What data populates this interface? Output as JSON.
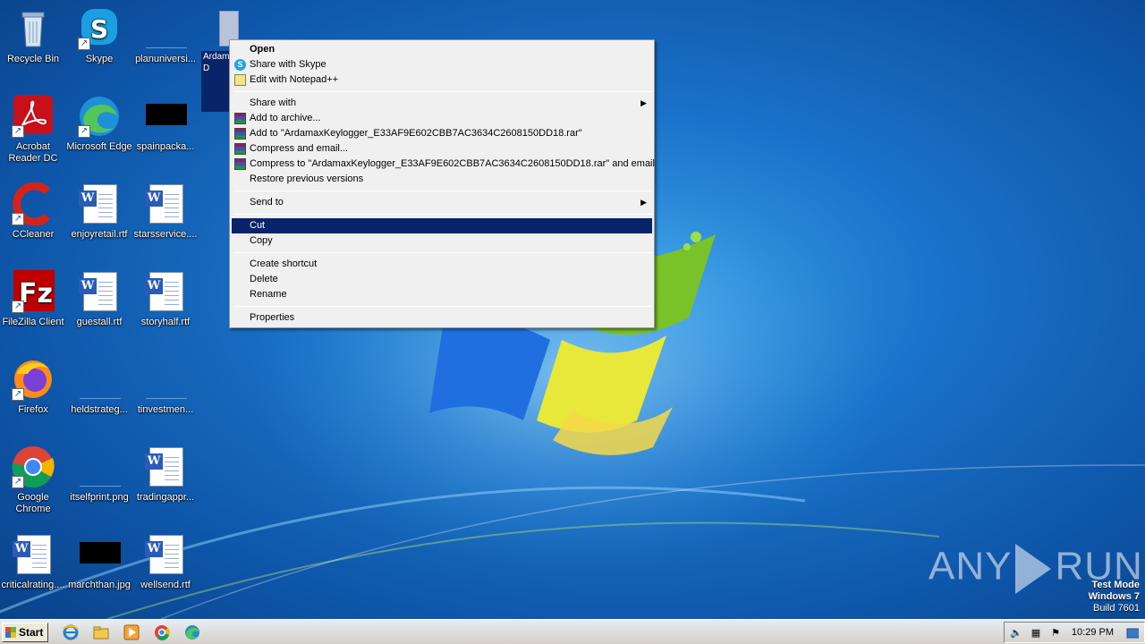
{
  "desktop": {
    "icons": [
      {
        "label": "Recycle Bin",
        "icon": "recycle-bin-icon"
      },
      {
        "label": "Skype",
        "icon": "skype-icon"
      },
      {
        "label": "planuniversi...",
        "icon": "blank-image-icon"
      },
      {
        "label": "Acrobat Reader DC",
        "icon": "acrobat-icon"
      },
      {
        "label": "Microsoft Edge",
        "icon": "edge-icon"
      },
      {
        "label": "spainpacka...",
        "icon": "black-image-icon"
      },
      {
        "label": "CCleaner",
        "icon": "ccleaner-icon"
      },
      {
        "label": "enjoyretail.rtf",
        "icon": "word-doc-icon"
      },
      {
        "label": "starsservice....",
        "icon": "word-doc-icon"
      },
      {
        "label": "FileZilla Client",
        "icon": "filezilla-icon"
      },
      {
        "label": "guestall.rtf",
        "icon": "word-doc-icon"
      },
      {
        "label": "storyhalf.rtf",
        "icon": "word-doc-icon"
      },
      {
        "label": "Firefox",
        "icon": "firefox-icon"
      },
      {
        "label": "heldstrateg...",
        "icon": "blank-image-icon"
      },
      {
        "label": "tinvestmen...",
        "icon": "blank-image-icon"
      },
      {
        "label": "Google Chrome",
        "icon": "chrome-icon"
      },
      {
        "label": "itselfprint.png",
        "icon": "blank-image-icon"
      },
      {
        "label": "tradingappr...",
        "icon": "word-doc-icon"
      },
      {
        "label": "criticalrating....",
        "icon": "word-doc-icon"
      },
      {
        "label": "marchthan.jpg",
        "icon": "black-image-icon"
      },
      {
        "label": "wellsend.rtf",
        "icon": "word-doc-icon"
      }
    ],
    "selected_file_label": "Ardamaxgger_E33602CB34C260 D"
  },
  "context_menu": {
    "items": [
      {
        "label": "Open",
        "bold": true
      },
      {
        "label": "Share with Skype",
        "icon": "skype"
      },
      {
        "label": "Edit with Notepad++",
        "icon": "notepad"
      },
      {
        "label": "Share with",
        "submenu": true
      },
      {
        "label": "Add to archive...",
        "icon": "rar"
      },
      {
        "label": "Add to \"ArdamaxKeylogger_E33AF9E602CBB7AC3634C2608150DD18.rar\"",
        "icon": "rar"
      },
      {
        "label": "Compress and email...",
        "icon": "rar"
      },
      {
        "label": "Compress to \"ArdamaxKeylogger_E33AF9E602CBB7AC3634C2608150DD18.rar\" and email",
        "icon": "rar"
      },
      {
        "label": "Restore previous versions"
      },
      {
        "label": "Send to",
        "submenu": true
      },
      {
        "label": "Cut",
        "highlighted": true
      },
      {
        "label": "Copy"
      },
      {
        "label": "Create shortcut"
      },
      {
        "label": "Delete"
      },
      {
        "label": "Rename"
      },
      {
        "label": "Properties"
      }
    ]
  },
  "watermark": {
    "left": "ANY",
    "right": "RUN"
  },
  "test_mode": {
    "line1": "Test Mode",
    "line2": "Windows 7",
    "line3": "Build 7601"
  },
  "taskbar": {
    "start_label": "Start",
    "clock": "10:29 PM"
  },
  "colors": {
    "menu_highlight": "#0a246a",
    "desktop_blue": "#1a73c9"
  }
}
